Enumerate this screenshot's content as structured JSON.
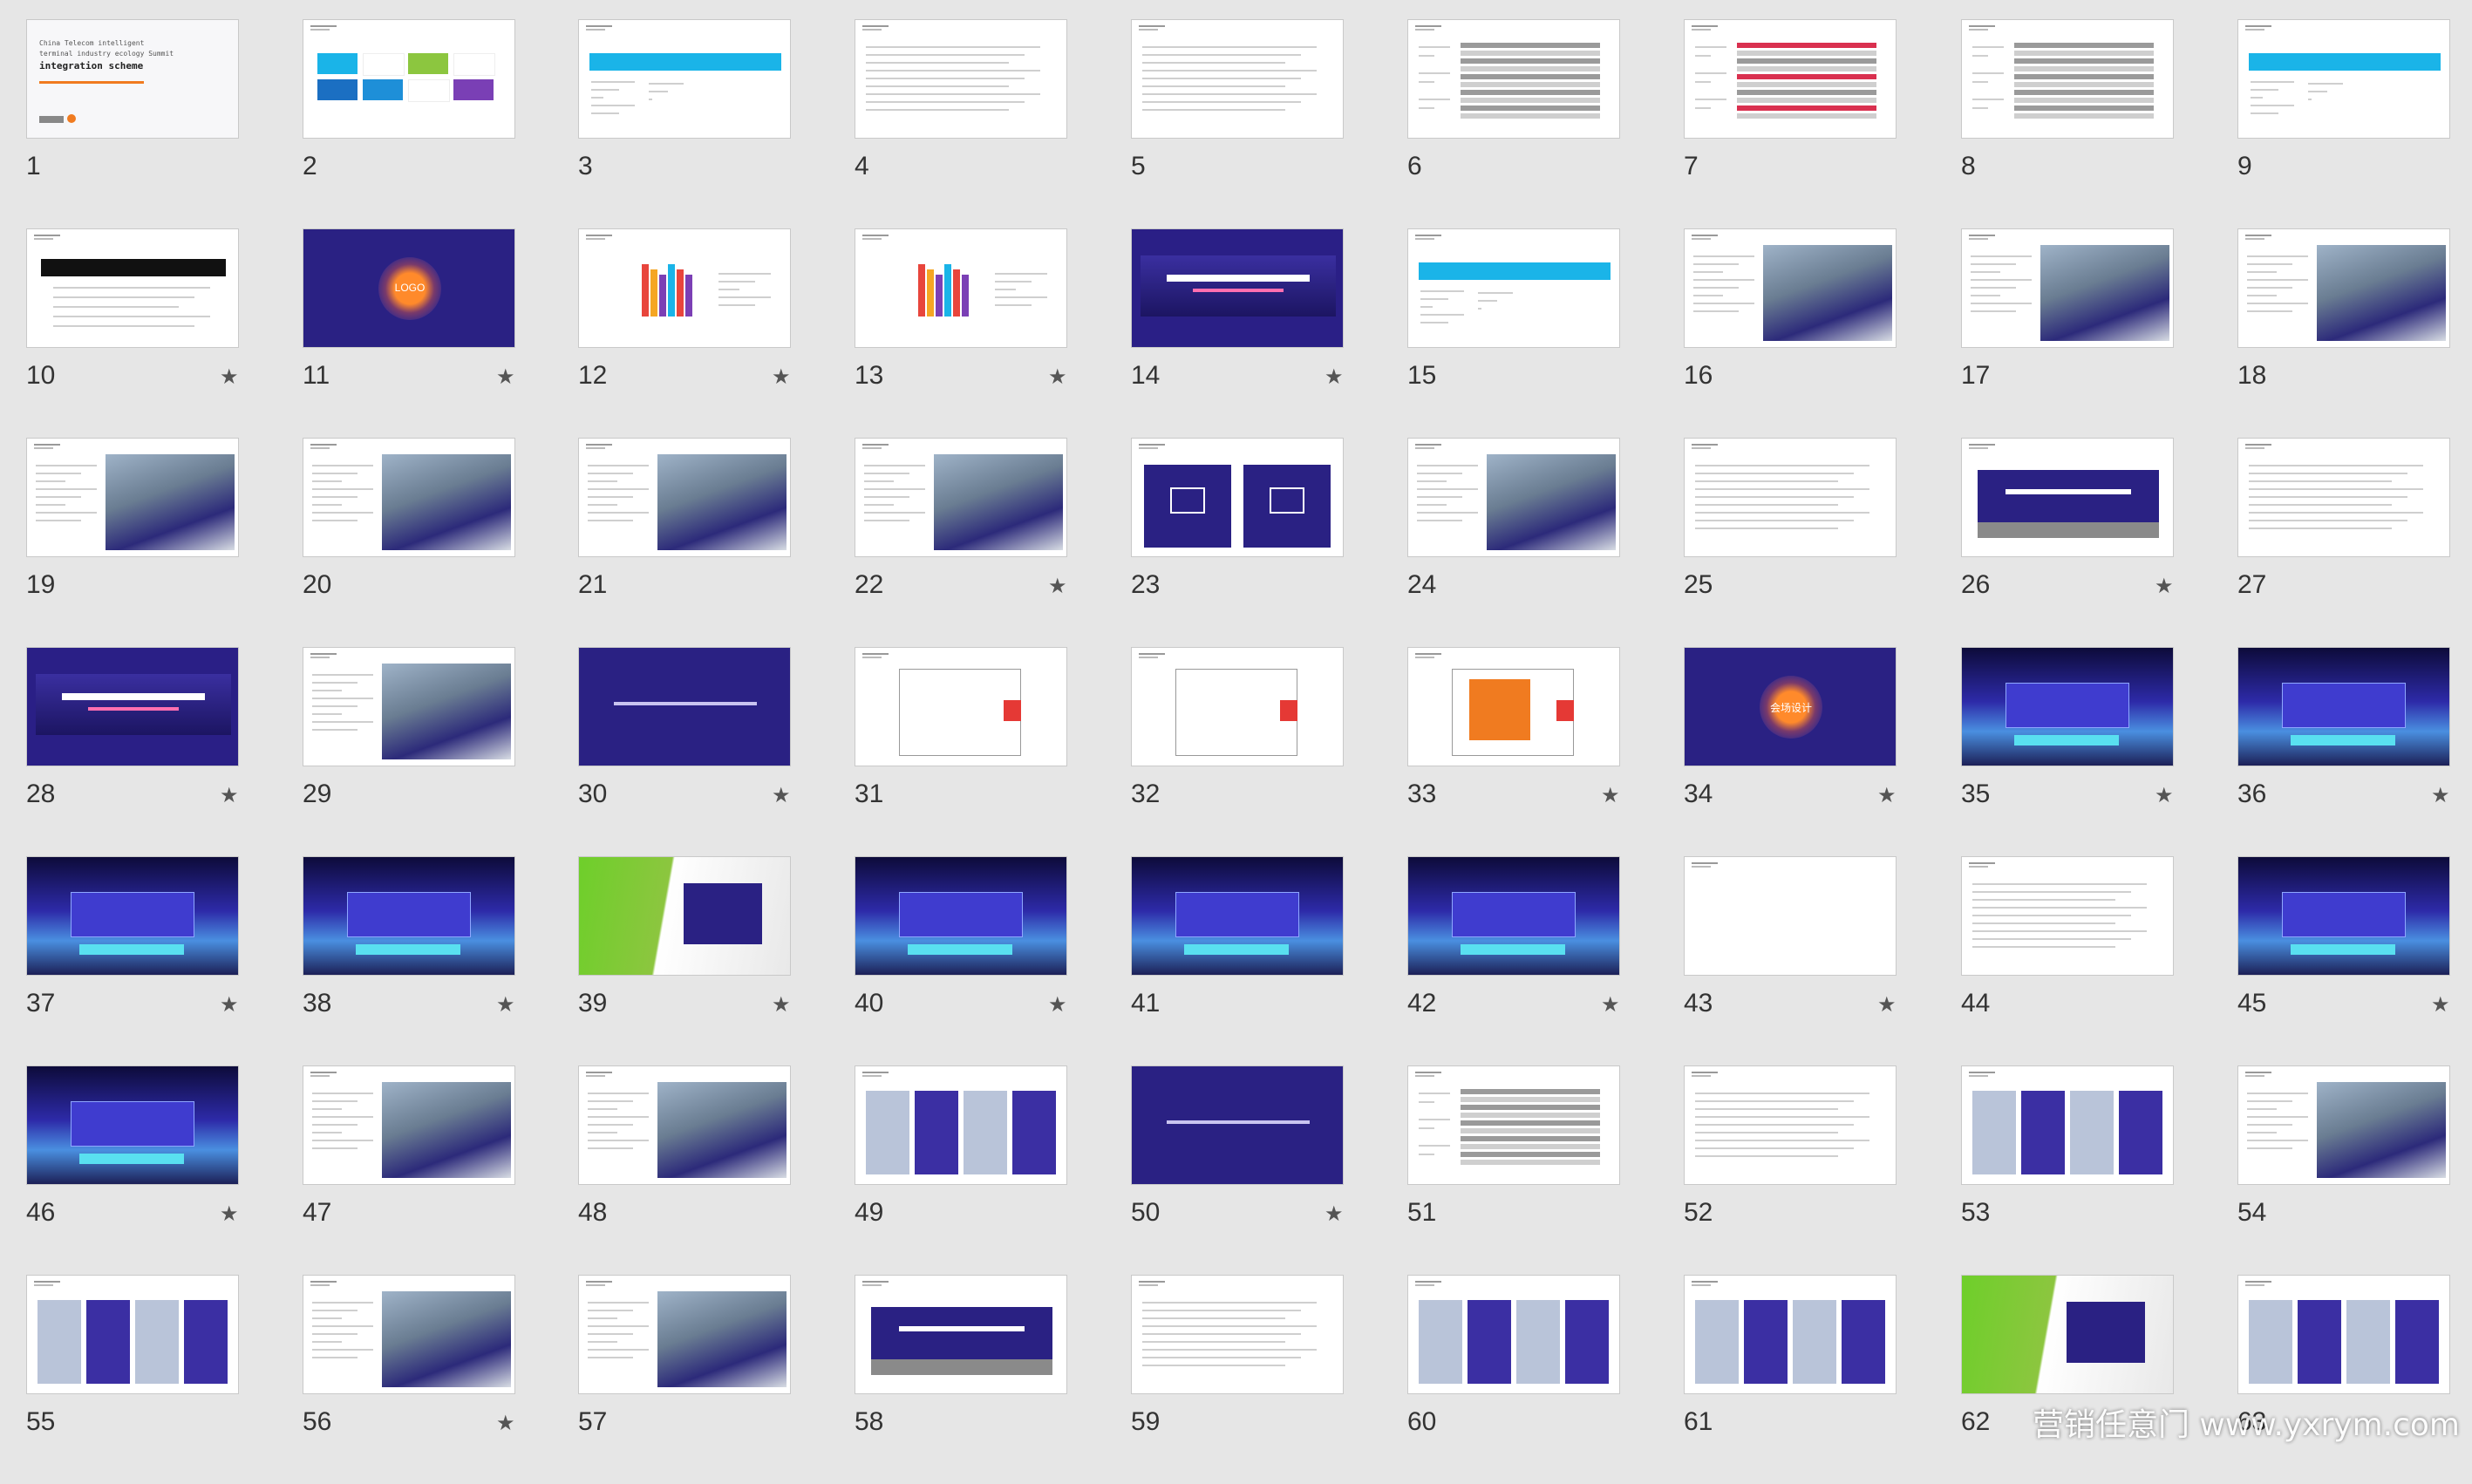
{
  "slides": [
    {
      "n": "1",
      "star": false,
      "kind": "title",
      "texts": [
        "China Telecom intelligent",
        "terminal industry ecology Summit",
        "integration scheme"
      ]
    },
    {
      "n": "2",
      "star": false,
      "kind": "palette"
    },
    {
      "n": "3",
      "star": false,
      "kind": "cyanbar"
    },
    {
      "n": "4",
      "star": false,
      "kind": "text"
    },
    {
      "n": "5",
      "star": false,
      "kind": "text"
    },
    {
      "n": "6",
      "star": false,
      "kind": "table"
    },
    {
      "n": "7",
      "star": false,
      "kind": "table2"
    },
    {
      "n": "8",
      "star": false,
      "kind": "table"
    },
    {
      "n": "9",
      "star": false,
      "kind": "cyanbar"
    },
    {
      "n": "10",
      "star": true,
      "kind": "blackbar"
    },
    {
      "n": "11",
      "star": true,
      "kind": "logo",
      "texts": [
        "LOGO"
      ]
    },
    {
      "n": "12",
      "star": true,
      "kind": "art"
    },
    {
      "n": "13",
      "star": true,
      "kind": "art"
    },
    {
      "n": "14",
      "star": true,
      "kind": "banner"
    },
    {
      "n": "15",
      "star": false,
      "kind": "cyanbar"
    },
    {
      "n": "16",
      "star": false,
      "kind": "photo"
    },
    {
      "n": "17",
      "star": false,
      "kind": "photo"
    },
    {
      "n": "18",
      "star": false,
      "kind": "photo"
    },
    {
      "n": "19",
      "star": false,
      "kind": "photo"
    },
    {
      "n": "20",
      "star": false,
      "kind": "photo"
    },
    {
      "n": "21",
      "star": false,
      "kind": "photo"
    },
    {
      "n": "22",
      "star": true,
      "kind": "photo"
    },
    {
      "n": "23",
      "star": false,
      "kind": "signs"
    },
    {
      "n": "24",
      "star": false,
      "kind": "photo"
    },
    {
      "n": "25",
      "star": false,
      "kind": "text"
    },
    {
      "n": "26",
      "star": true,
      "kind": "stage"
    },
    {
      "n": "27",
      "star": false,
      "kind": "text"
    },
    {
      "n": "28",
      "star": true,
      "kind": "banner"
    },
    {
      "n": "29",
      "star": false,
      "kind": "photo"
    },
    {
      "n": "30",
      "star": true,
      "kind": "purple"
    },
    {
      "n": "31",
      "star": false,
      "kind": "plan"
    },
    {
      "n": "32",
      "star": false,
      "kind": "plan"
    },
    {
      "n": "33",
      "star": true,
      "kind": "plan2"
    },
    {
      "n": "34",
      "star": true,
      "kind": "logo",
      "texts": [
        "会场设计"
      ]
    },
    {
      "n": "35",
      "star": true,
      "kind": "render"
    },
    {
      "n": "36",
      "star": true,
      "kind": "render"
    },
    {
      "n": "37",
      "star": true,
      "kind": "render"
    },
    {
      "n": "38",
      "star": true,
      "kind": "render"
    },
    {
      "n": "39",
      "star": true,
      "kind": "green"
    },
    {
      "n": "40",
      "star": true,
      "kind": "render"
    },
    {
      "n": "41",
      "star": false,
      "kind": "render"
    },
    {
      "n": "42",
      "star": true,
      "kind": "render"
    },
    {
      "n": "43",
      "star": true,
      "kind": "blank"
    },
    {
      "n": "44",
      "star": false,
      "kind": "text"
    },
    {
      "n": "45",
      "star": true,
      "kind": "render"
    },
    {
      "n": "46",
      "star": true,
      "kind": "render"
    },
    {
      "n": "47",
      "star": false,
      "kind": "photo"
    },
    {
      "n": "48",
      "star": false,
      "kind": "photo"
    },
    {
      "n": "49",
      "star": false,
      "kind": "collage"
    },
    {
      "n": "50",
      "star": true,
      "kind": "purple"
    },
    {
      "n": "51",
      "star": false,
      "kind": "table"
    },
    {
      "n": "52",
      "star": false,
      "kind": "text"
    },
    {
      "n": "53",
      "star": false,
      "kind": "collage"
    },
    {
      "n": "54",
      "star": false,
      "kind": "photo"
    },
    {
      "n": "55",
      "star": false,
      "kind": "collage"
    },
    {
      "n": "56",
      "star": true,
      "kind": "photo"
    },
    {
      "n": "57",
      "star": false,
      "kind": "photo"
    },
    {
      "n": "58",
      "star": false,
      "kind": "stage"
    },
    {
      "n": "59",
      "star": false,
      "kind": "text"
    },
    {
      "n": "60",
      "star": false,
      "kind": "collage"
    },
    {
      "n": "61",
      "star": false,
      "kind": "collage"
    },
    {
      "n": "62",
      "star": false,
      "kind": "green"
    },
    {
      "n": "63",
      "star": false,
      "kind": "collage"
    }
  ],
  "star_glyph": "★",
  "watermark": "营销任意门 www.yxrym.com",
  "colors": {
    "background": "#e6e6e6",
    "purple": "#2a2183",
    "cyan": "#1ab4e8",
    "orange": "#f07b20",
    "green": "#8cc63f"
  }
}
